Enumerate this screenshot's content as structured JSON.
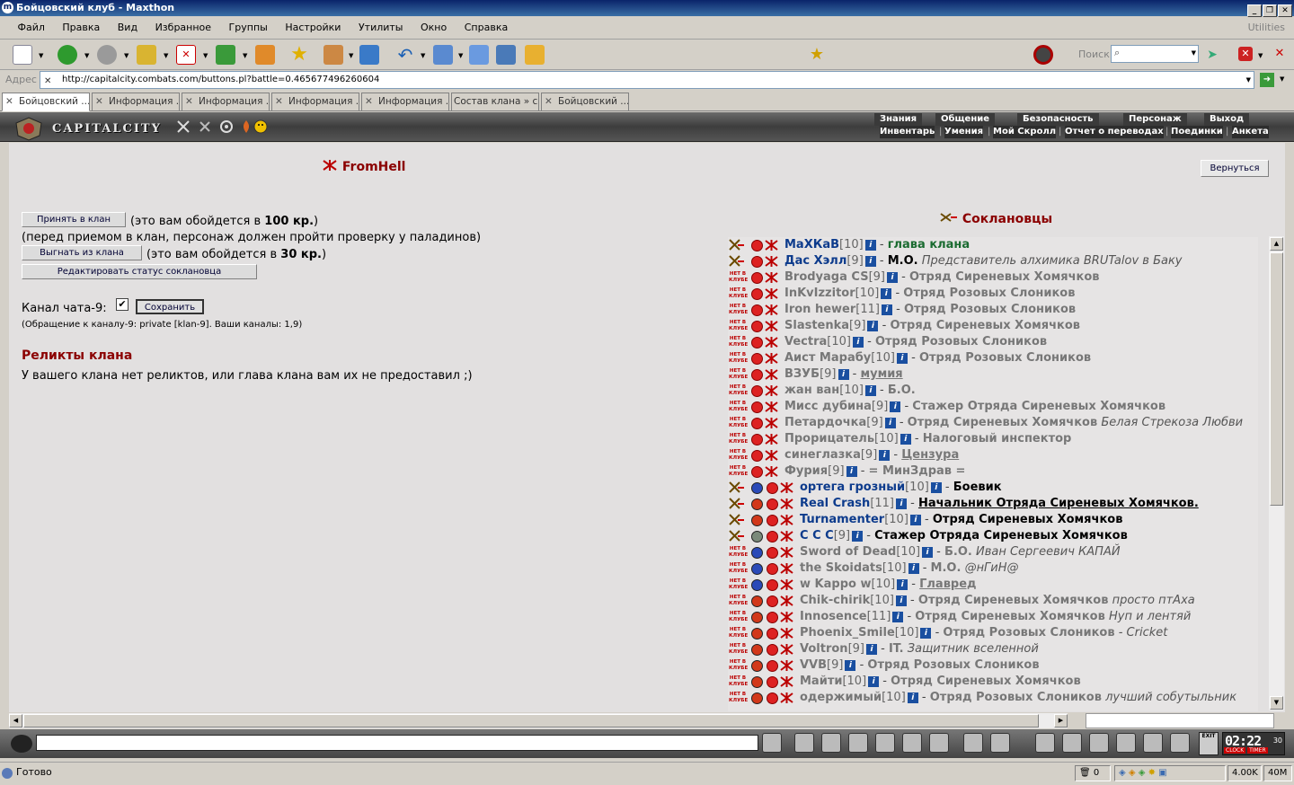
{
  "window": {
    "title": "Бойцовский клуб - Maxthon"
  },
  "menu": [
    "Файл",
    "Правка",
    "Вид",
    "Избранное",
    "Группы",
    "Настройки",
    "Утилиты",
    "Окно",
    "Справка"
  ],
  "utilities_label": "Utilities",
  "search": {
    "label": "Поиск"
  },
  "address": {
    "label": "Адрес",
    "url": "http://capitalcity.combats.com/buttons.pl?battle=0.465677496260604"
  },
  "tabs": [
    "Бойцовский ...",
    "Информация ...",
    "Информация ...",
    "Информация ...",
    "Информация ...",
    "Состав клана » с...",
    "Бойцовский ..."
  ],
  "game_header": {
    "city": "CAPITALCITY",
    "nav_top": [
      "Знания",
      "Общение",
      "Безопасность",
      "Персонаж",
      "Выход"
    ],
    "nav_bottom": [
      "Инвентарь",
      "Умения",
      "Мой Скролл",
      "Отчет о переводах",
      "Поединки",
      "Анкета"
    ]
  },
  "clan": {
    "name": "FromHell",
    "back_button": "Вернуться",
    "accept_button": "Принять в клан",
    "accept_cost_prefix": "(это вам обойдется в",
    "accept_cost_value": "100 кр.",
    "accept_cost_suffix": ")",
    "accept_note": "(перед приемом в клан, персонаж должен пройти проверку у паладинов)",
    "kick_button": "Выгнать из клана",
    "kick_cost_prefix": "(это вам обойдется в",
    "kick_cost_value": "30 кр.",
    "kick_cost_suffix": ")",
    "edit_status_button": "Редактировать статус соклановца",
    "chat_channel_label": "Канал чата-9:",
    "chat_channel_checked": true,
    "save_button": "Сохранить",
    "chat_note": "(Обращение к каналу-9: private [klan-9]. Ваши каналы: 1,9)",
    "relics_title": "Реликты клана",
    "relics_text": "У вашего клана нет реликтов, или глава клана вам их не предоставил ;)"
  },
  "members_title": "Соклановцы",
  "members": [
    {
      "nick": "МаХКаВ",
      "level": "[10]",
      "sep": " - ",
      "rank": "глава клана",
      "desc": "",
      "online": true,
      "align": "dark",
      "rank_style": "green"
    },
    {
      "nick": "Дас Хэлл",
      "level": "[9]",
      "sep": " - ",
      "rank": "М.О.",
      "desc": "Представитель алхимика BRUTalov в Баку",
      "online": true,
      "align": "dark",
      "rank_style": "bold"
    },
    {
      "nick": "Brodyaga CS",
      "level": "[9]",
      "sep": " - ",
      "rank": "Отряд Сиреневых Хомячков",
      "desc": "",
      "online": false,
      "align": "dark"
    },
    {
      "nick": "InKvIzzitor",
      "level": "[10]",
      "sep": " - ",
      "rank": "Отряд Розовых Слоников",
      "desc": "",
      "online": false,
      "align": "dark"
    },
    {
      "nick": "Iron hewer",
      "level": "[11]",
      "sep": " - ",
      "rank": "Отряд Розовых Слоников",
      "desc": "",
      "online": false,
      "align": "dark"
    },
    {
      "nick": "Slastenka",
      "level": "[9]",
      "sep": " - ",
      "rank": "Отряд Сиреневых Хомячков",
      "desc": "",
      "online": false,
      "align": "dark"
    },
    {
      "nick": "Vectra",
      "level": "[10]",
      "sep": " - ",
      "rank": "Отряд Розовых Слоников",
      "desc": "",
      "online": false,
      "align": "dark"
    },
    {
      "nick": "Аист Марабу",
      "level": "[10]",
      "sep": " - ",
      "rank": "Отряд Розовых Слоников",
      "desc": "",
      "online": false,
      "align": "dark"
    },
    {
      "nick": "ВЗУБ",
      "level": "[9]",
      "sep": " - ",
      "rank": "мумия",
      "desc": "",
      "online": false,
      "align": "dark",
      "rank_style": "underline"
    },
    {
      "nick": "жан ван",
      "level": "[10]",
      "sep": " - ",
      "rank": "Б.О.",
      "desc": "",
      "online": false,
      "align": "dark"
    },
    {
      "nick": "Мисс дубина",
      "level": "[9]",
      "sep": " - ",
      "rank": "Стажер Отряда Сиреневых Хомячков",
      "desc": "",
      "online": false,
      "align": "dark"
    },
    {
      "nick": "Петардочка",
      "level": "[9]",
      "sep": " - ",
      "rank": "Отряд Сиреневых Хомячков",
      "desc": "Белая Стрекоза Любви",
      "online": false,
      "align": "dark"
    },
    {
      "nick": "Прорицатель",
      "level": "[10]",
      "sep": " - ",
      "rank": "Налоговый инспектор",
      "desc": "",
      "online": false,
      "align": "dark"
    },
    {
      "nick": "синеглазка",
      "level": "[9]",
      "sep": " - ",
      "rank": "Цензура",
      "desc": "",
      "online": false,
      "align": "dark",
      "rank_style": "underline"
    },
    {
      "nick": "Фурия",
      "level": "[9]",
      "sep": " - ",
      "rank": "= МинЗдрав =",
      "desc": "",
      "online": false,
      "align": "dark"
    },
    {
      "nick": "ортега грозный",
      "level": "[10]",
      "sep": " - ",
      "rank": "Боевик",
      "desc": "",
      "online": true,
      "align": "blue",
      "rank_style": "bold"
    },
    {
      "nick": "Real Crash",
      "level": "[11]",
      "sep": " - ",
      "rank": "Начальник Отряда Сиреневых Хомячков.",
      "desc": "",
      "online": true,
      "align": "fire",
      "rank_style": "bold-underline"
    },
    {
      "nick": "Turnamenter",
      "level": "[10]",
      "sep": " - ",
      "rank": "Отряд Сиреневых Хомячков",
      "desc": "",
      "online": true,
      "align": "fire",
      "rank_style": "bold"
    },
    {
      "nick": "С С С",
      "level": "[9]",
      "sep": " - ",
      "rank": "Стажер Отряда Сиреневых Хомячков",
      "desc": "",
      "online": true,
      "align": "gray",
      "rank_style": "bold"
    },
    {
      "nick": "Sword of Dead",
      "level": "[10]",
      "sep": " - ",
      "rank": "Б.О.",
      "desc": "Иван Сергеевич КАПАЙ",
      "online": false,
      "align": "blue"
    },
    {
      "nick": "the Skoidats",
      "level": "[10]",
      "sep": " - ",
      "rank": "М.О.",
      "desc": "@нГиН@",
      "online": false,
      "align": "blue"
    },
    {
      "nick": "w Kappo w",
      "level": "[10]",
      "sep": " - ",
      "rank": "Главред",
      "desc": "",
      "online": false,
      "align": "blue",
      "rank_style": "underline"
    },
    {
      "nick": "Chik-chirik",
      "level": "[10]",
      "sep": " - ",
      "rank": "Отряд Сиреневых Хомячков",
      "desc": "просто птАха",
      "online": false,
      "align": "fire"
    },
    {
      "nick": "Innosence",
      "level": "[11]",
      "sep": " - ",
      "rank": "Отряд Сиреневых Хомячков",
      "desc": "Нуп и лентяй",
      "online": false,
      "align": "fire"
    },
    {
      "nick": "Phoenix_Smile",
      "level": "[10]",
      "sep": " - ",
      "rank": "Отряд Розовых Слоников",
      "desc": "- Cricket",
      "online": false,
      "align": "fire"
    },
    {
      "nick": "Voltron",
      "level": "[9]",
      "sep": " - ",
      "rank": "IT.",
      "desc": "Защитник вселенной",
      "online": false,
      "align": "fire"
    },
    {
      "nick": "VVB",
      "level": "[9]",
      "sep": " - ",
      "rank": "Отряд Розовых Слоников",
      "desc": "",
      "online": false,
      "align": "fire"
    },
    {
      "nick": "Майти",
      "level": "[10]",
      "sep": " - ",
      "rank": "Отряд Сиреневых Хомячков",
      "desc": "",
      "online": false,
      "align": "fire"
    },
    {
      "nick": "одержимый",
      "level": "[10]",
      "sep": " - ",
      "rank": "Отряд Розовых Слоников",
      "desc": "лучший собутыльник",
      "online": false,
      "align": "fire"
    }
  ],
  "offline_badge": "НЕТ В КЛУБЕ",
  "info_icon": "i",
  "clock": {
    "time": "02:22",
    "seconds": "30",
    "label_left": "CLOCK",
    "label_right": "TIMER",
    "exit": "EXIT"
  },
  "status": {
    "text": "Готово",
    "count": "0",
    "traffic": "4.00K",
    "memory": "40M"
  },
  "colors": {
    "clan_red": "#8b0000",
    "online_nick": "#0d3b8c",
    "online_rank": "#1a6b30",
    "offline_text": "#777777"
  }
}
